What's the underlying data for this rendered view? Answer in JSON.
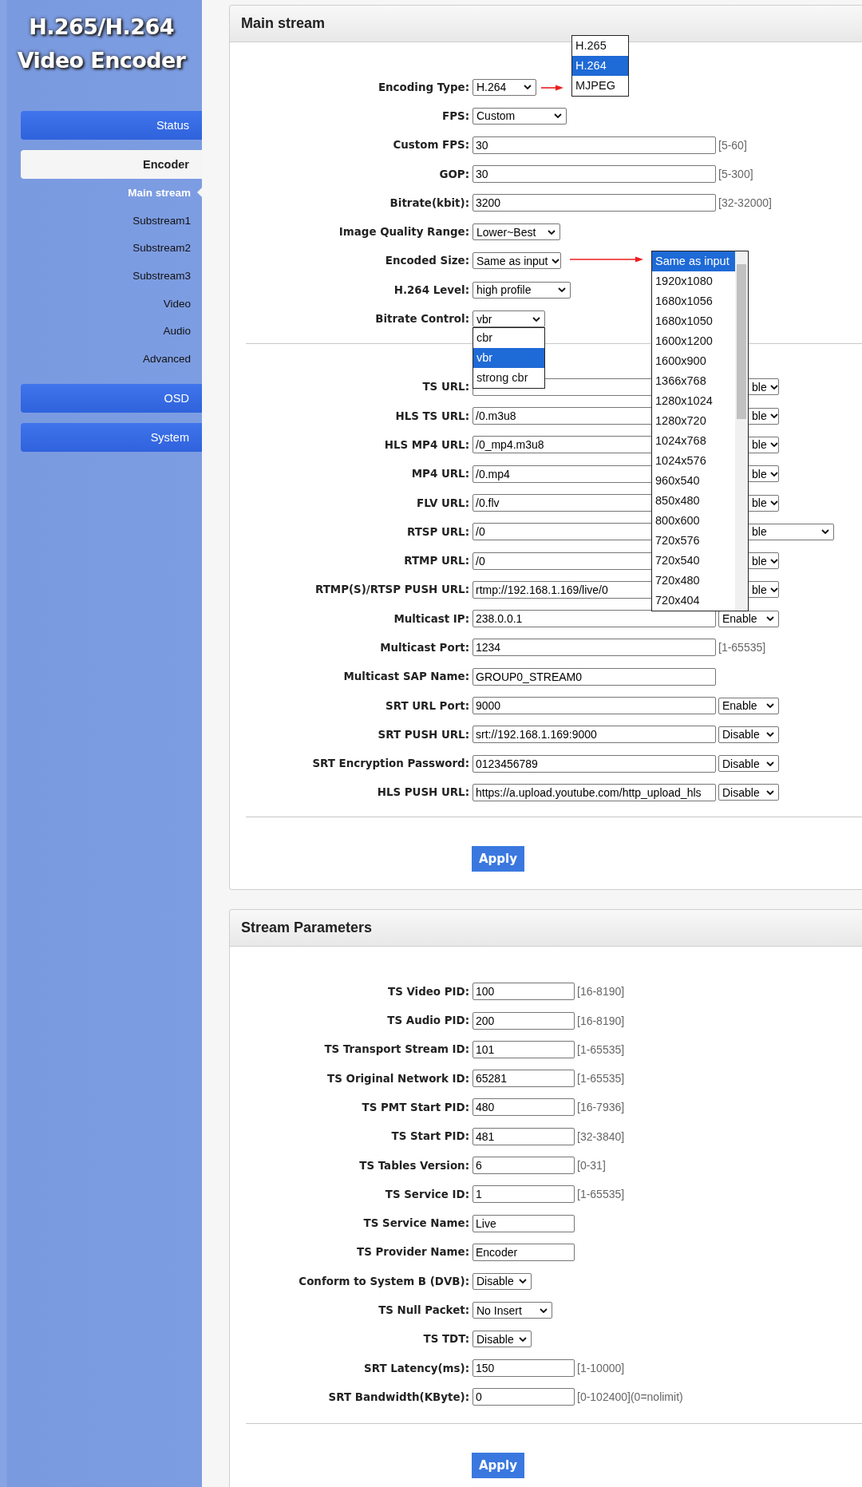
{
  "sidebar": {
    "title": "H.265/H.264 Video Encoder",
    "items": [
      {
        "label": "Status",
        "selected": false
      },
      {
        "label": "Encoder",
        "selected": true,
        "children": [
          {
            "label": "Main stream",
            "selected": true
          },
          {
            "label": "Substream1",
            "selected": false
          },
          {
            "label": "Substream2",
            "selected": false
          },
          {
            "label": "Substream3",
            "selected": false
          },
          {
            "label": "Video",
            "selected": false
          },
          {
            "label": "Audio",
            "selected": false
          },
          {
            "label": "Advanced",
            "selected": false
          }
        ]
      },
      {
        "label": "OSD",
        "selected": false
      },
      {
        "label": "System",
        "selected": false
      }
    ]
  },
  "main_stream": {
    "title": "Main stream",
    "groups": [
      {
        "rows": [
          {
            "label": "Encoding Type:",
            "kind": "select",
            "value": "H.264",
            "popup": {
              "kind": "raised",
              "options": [
                {
                  "label": "H.265",
                  "selected": false
                },
                {
                  "label": "H.264",
                  "selected": true
                },
                {
                  "label": "MJPEG",
                  "selected": false
                }
              ]
            }
          },
          {
            "label": "FPS:",
            "kind": "select",
            "value": "Custom"
          },
          {
            "label": "Custom FPS:",
            "kind": "input",
            "value": "30",
            "hint": "[5-60]"
          },
          {
            "label": "GOP:",
            "kind": "input",
            "value": "30",
            "hint": "[5-300]"
          },
          {
            "label": "Bitrate(kbit):",
            "kind": "input",
            "value": "3200",
            "hint": "[32-32000]"
          },
          {
            "label": "Image Quality Range:",
            "kind": "select",
            "value": "Lower~Best"
          },
          {
            "label": "Encoded Size:",
            "kind": "select",
            "value": "Same as input",
            "popup": {
              "kind": "aside",
              "options": [
                {
                  "label": "Same as input",
                  "selected": true
                },
                {
                  "label": "1920x1080",
                  "selected": false
                },
                {
                  "label": "1680x1056",
                  "selected": false
                },
                {
                  "label": "1680x1050",
                  "selected": false
                },
                {
                  "label": "1600x1200",
                  "selected": false
                },
                {
                  "label": "1600x900",
                  "selected": false
                },
                {
                  "label": "1366x768",
                  "selected": false
                },
                {
                  "label": "1280x1024",
                  "selected": false
                },
                {
                  "label": "1280x720",
                  "selected": false
                },
                {
                  "label": "1024x768",
                  "selected": false
                },
                {
                  "label": "1024x576",
                  "selected": false
                },
                {
                  "label": "960x540",
                  "selected": false
                },
                {
                  "label": "850x480",
                  "selected": false
                },
                {
                  "label": "800x600",
                  "selected": false
                },
                {
                  "label": "720x576",
                  "selected": false
                },
                {
                  "label": "720x540",
                  "selected": false
                },
                {
                  "label": "720x480",
                  "selected": false
                },
                {
                  "label": "720x404",
                  "selected": false
                }
              ]
            }
          },
          {
            "label": "H.264 Level:",
            "kind": "select",
            "value": "high profile"
          },
          {
            "label": "Bitrate Control:",
            "kind": "select",
            "value": "vbr",
            "popup": {
              "kind": "drop",
              "options": [
                {
                  "label": "cbr",
                  "selected": false
                },
                {
                  "label": "vbr",
                  "selected": true
                },
                {
                  "label": "strong cbr",
                  "selected": false
                }
              ]
            }
          }
        ]
      },
      {
        "rows": [
          {
            "label": "TS URL:",
            "kind": "input",
            "toggle": "ble"
          },
          {
            "label": "HLS TS URL:",
            "kind": "input",
            "value": "/0.m3u8",
            "toggle": "ble"
          },
          {
            "label": "HLS MP4 URL:",
            "kind": "input",
            "value": "/0_mp4.m3u8",
            "toggle": "ble"
          },
          {
            "label": "MP4 URL:",
            "kind": "input",
            "value": "/0.mp4",
            "toggle": "ble"
          },
          {
            "label": "FLV URL:",
            "kind": "input",
            "value": "/0.flv",
            "toggle": "ble"
          },
          {
            "label": "RTSP URL:",
            "kind": "input",
            "value": "/0",
            "toggle": "ble"
          },
          {
            "label": "RTMP URL:",
            "kind": "input",
            "value": "/0",
            "toggle": "ble"
          },
          {
            "label": "RTMP(S)/RTSP PUSH URL:",
            "kind": "input",
            "value": "rtmp://192.168.1.169/live/0",
            "toggle": "ble"
          },
          {
            "label": "Multicast IP:",
            "kind": "input",
            "value": "238.0.0.1",
            "toggle": "Enable"
          },
          {
            "label": "Multicast Port:",
            "kind": "input",
            "value": "1234",
            "hint": "[1-65535]"
          },
          {
            "label": "Multicast SAP Name:",
            "kind": "input",
            "value": "GROUP0_STREAM0"
          },
          {
            "label": "SRT URL Port:",
            "kind": "input",
            "value": "9000",
            "toggle": "Enable"
          },
          {
            "label": "SRT PUSH URL:",
            "kind": "input",
            "value": "srt://192.168.1.169:9000",
            "toggle": "Disable"
          },
          {
            "label": "SRT Encryption Password:",
            "kind": "input",
            "value": "0123456789",
            "toggle": "Disable"
          },
          {
            "label": "HLS PUSH URL:",
            "kind": "input",
            "value": "https://a.upload.youtube.com/http_upload_hls",
            "toggle": "Disable"
          }
        ]
      }
    ],
    "apply": "Apply"
  },
  "stream_parameters": {
    "title": "Stream Parameters",
    "groups": [
      {
        "rows": [
          {
            "label": "TS Video PID:",
            "kind": "input",
            "value": "100",
            "hint": "[16-8190]"
          },
          {
            "label": "TS Audio PID:",
            "kind": "input",
            "value": "200",
            "hint": "[16-8190]"
          },
          {
            "label": "TS Transport Stream ID:",
            "kind": "input",
            "value": "101",
            "hint": "[1-65535]"
          },
          {
            "label": "TS Original Network ID:",
            "kind": "input",
            "value": "65281",
            "hint": "[1-65535]"
          },
          {
            "label": "TS PMT Start PID:",
            "kind": "input",
            "value": "480",
            "hint": "[16-7936]"
          },
          {
            "label": "TS Start PID:",
            "kind": "input",
            "value": "481",
            "hint": "[32-3840]"
          },
          {
            "label": "TS Tables Version:",
            "kind": "input",
            "value": "6",
            "hint": "[0-31]"
          },
          {
            "label": "TS Service ID:",
            "kind": "input",
            "value": "1",
            "hint": "[1-65535]"
          },
          {
            "label": "TS Service Name:",
            "kind": "input",
            "value": "Live"
          },
          {
            "label": "TS Provider Name:",
            "kind": "input",
            "value": "Encoder"
          },
          {
            "label": "Conform to System B (DVB):",
            "kind": "select",
            "value": "Disable"
          },
          {
            "label": "TS Null Packet:",
            "kind": "select",
            "value": "No Insert"
          },
          {
            "label": "TS TDT:",
            "kind": "select",
            "value": "Disable"
          },
          {
            "label": "SRT Latency(ms):",
            "kind": "input",
            "value": "150",
            "hint": "[1-10000]"
          },
          {
            "label": "SRT Bandwidth(KByte):",
            "kind": "input",
            "value": "0",
            "hint": "[0-102400](0=nolimit)"
          }
        ]
      }
    ],
    "apply": "Apply"
  }
}
